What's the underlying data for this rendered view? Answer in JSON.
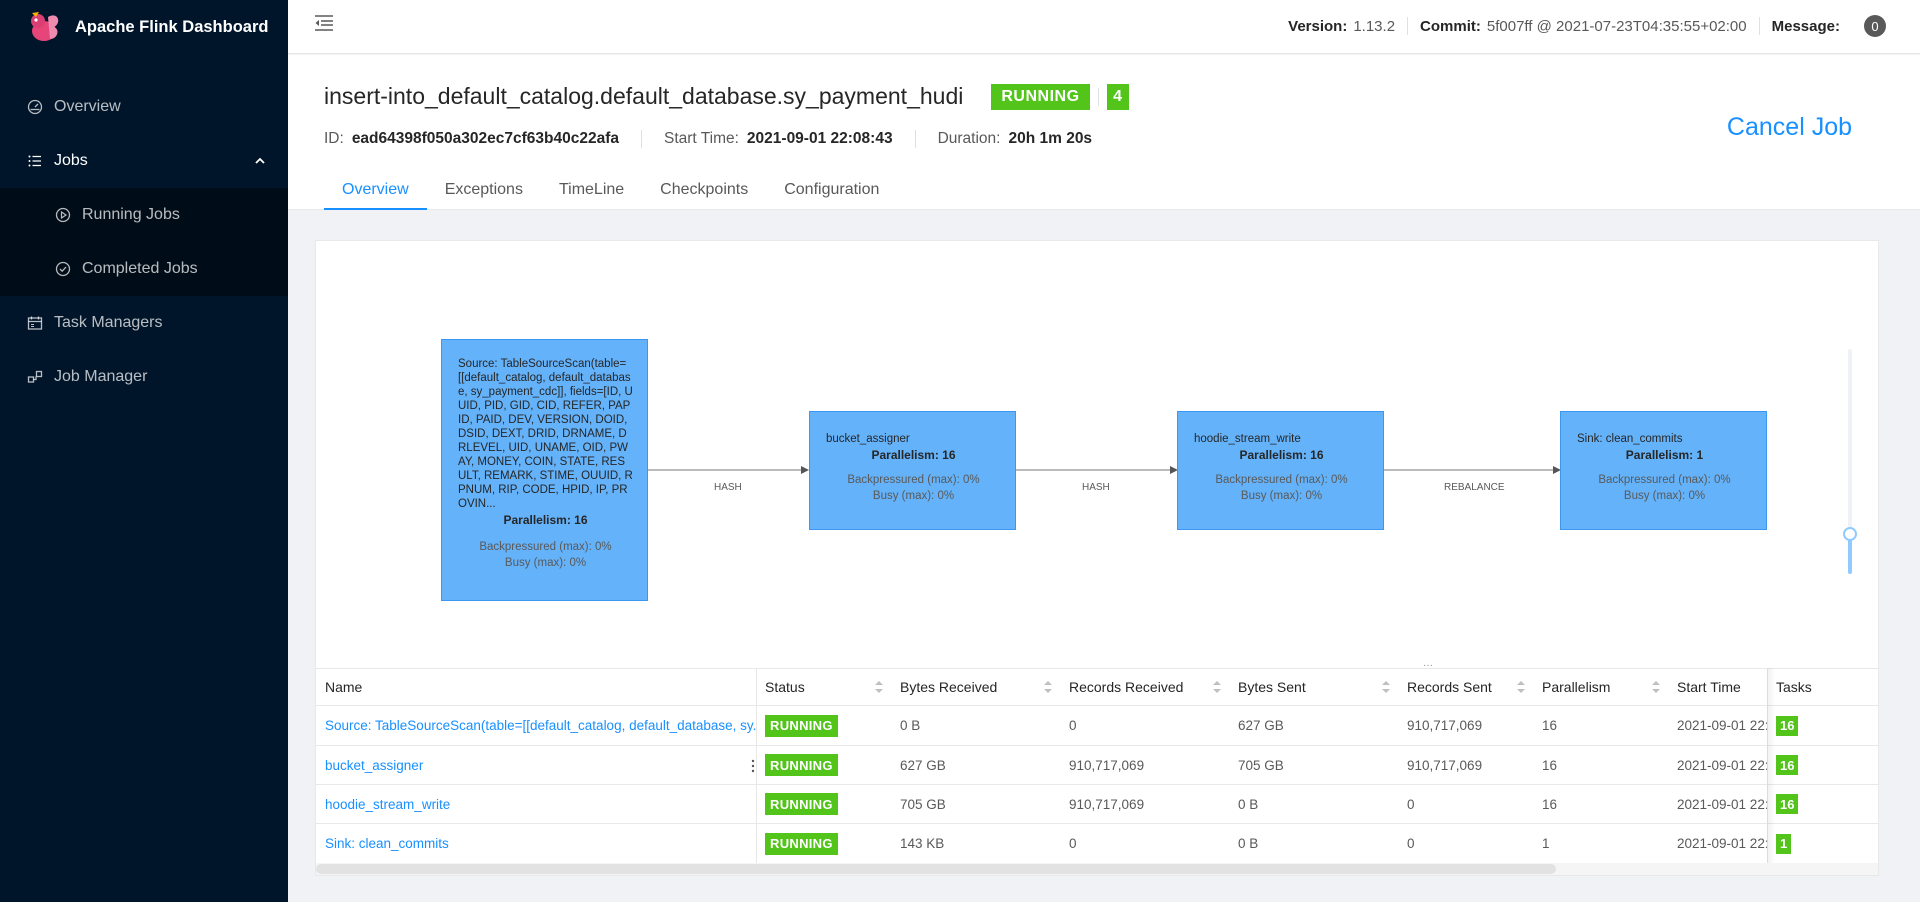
{
  "app": {
    "title": "Apache Flink Dashboard",
    "accent": "#1890ff",
    "sidebar_bg": "#001529",
    "running_color": "#52c41a",
    "node_color": "#64b2fa"
  },
  "sidebar": {
    "overview": "Overview",
    "jobs": "Jobs",
    "running_jobs": "Running Jobs",
    "completed_jobs": "Completed Jobs",
    "task_managers": "Task Managers",
    "job_manager": "Job Manager"
  },
  "header": {
    "version_label": "Version:",
    "version": "1.13.2",
    "commit_label": "Commit:",
    "commit": "5f007ff @ 2021-07-23T04:35:55+02:00",
    "message_label": "Message:",
    "message_count": "0"
  },
  "job": {
    "name": "insert-into_default_catalog.default_database.sy_payment_hudi",
    "status": "RUNNING",
    "task_count": "4",
    "id_label": "ID:",
    "id": "ead64398f050a302ec7cf63b40c22afa",
    "start_label": "Start Time:",
    "start_time": "2021-09-01 22:08:43",
    "duration_label": "Duration:",
    "duration": "20h 1m 20s",
    "cancel_label": "Cancel Job"
  },
  "tabs": [
    "Overview",
    "Exceptions",
    "TimeLine",
    "Checkpoints",
    "Configuration"
  ],
  "graph": {
    "nodes": [
      {
        "title": "Source: TableSourceScan(table=[[default_catalog, default_database, sy_payment_cdc]], fields=[ID, UUID, PID, GID, CID, REFER, PAPID, PAID, DEV, VERSION, DOID, DSID, DEXT, DRID, DRNAME, DRLEVEL, UID, UNAME, OID, PWAY, MONEY, COIN, STATE, RESULT, REMARK, STIME, OUUID, RPNUM, RIP, CODE, HPID, IP, PROVIN...",
        "parallelism": "Parallelism: 16",
        "backpressured": "Backpressured (max): 0%",
        "busy": "Busy (max): 0%"
      },
      {
        "title": "bucket_assigner",
        "parallelism": "Parallelism: 16",
        "backpressured": "Backpressured (max): 0%",
        "busy": "Busy (max): 0%"
      },
      {
        "title": "hoodie_stream_write",
        "parallelism": "Parallelism: 16",
        "backpressured": "Backpressured (max): 0%",
        "busy": "Busy (max): 0%"
      },
      {
        "title": "Sink: clean_commits",
        "parallelism": "Parallelism: 1",
        "backpressured": "Backpressured (max): 0%",
        "busy": "Busy (max): 0%"
      }
    ],
    "edges": [
      "HASH",
      "HASH",
      "REBALANCE"
    ]
  },
  "table": {
    "headers": {
      "name": "Name",
      "status": "Status",
      "bytes_received": "Bytes Received",
      "records_received": "Records Received",
      "bytes_sent": "Bytes Sent",
      "records_sent": "Records Sent",
      "parallelism": "Parallelism",
      "start_time": "Start Time",
      "tasks": "Tasks"
    },
    "rows": [
      {
        "name": "Source: TableSourceScan(table=[[default_catalog, default_database, sy...",
        "status": "RUNNING",
        "bytes_received": "0 B",
        "records_received": "0",
        "bytes_sent": "627 GB",
        "records_sent": "910,717,069",
        "parallelism": "16",
        "start_time": "2021-09-01 22:",
        "tasks": "16"
      },
      {
        "name": "bucket_assigner",
        "status": "RUNNING",
        "bytes_received": "627 GB",
        "records_received": "910,717,069",
        "bytes_sent": "705 GB",
        "records_sent": "910,717,069",
        "parallelism": "16",
        "start_time": "2021-09-01 22:",
        "tasks": "16"
      },
      {
        "name": "hoodie_stream_write",
        "status": "RUNNING",
        "bytes_received": "705 GB",
        "records_received": "910,717,069",
        "bytes_sent": "0 B",
        "records_sent": "0",
        "parallelism": "16",
        "start_time": "2021-09-01 22:",
        "tasks": "16"
      },
      {
        "name": "Sink: clean_commits",
        "status": "RUNNING",
        "bytes_received": "143 KB",
        "records_received": "0",
        "bytes_sent": "0 B",
        "records_sent": "0",
        "parallelism": "1",
        "start_time": "2021-09-01 22:",
        "tasks": "1"
      }
    ]
  },
  "icons": {
    "logo": "flink-squirrel-logo",
    "overview": "dashboard-icon",
    "jobs": "unordered-list-icon",
    "running": "play-circle-icon",
    "completed": "check-circle-icon",
    "task_managers": "schedule-icon",
    "job_manager": "cluster-icon",
    "fold": "menu-fold-icon"
  }
}
